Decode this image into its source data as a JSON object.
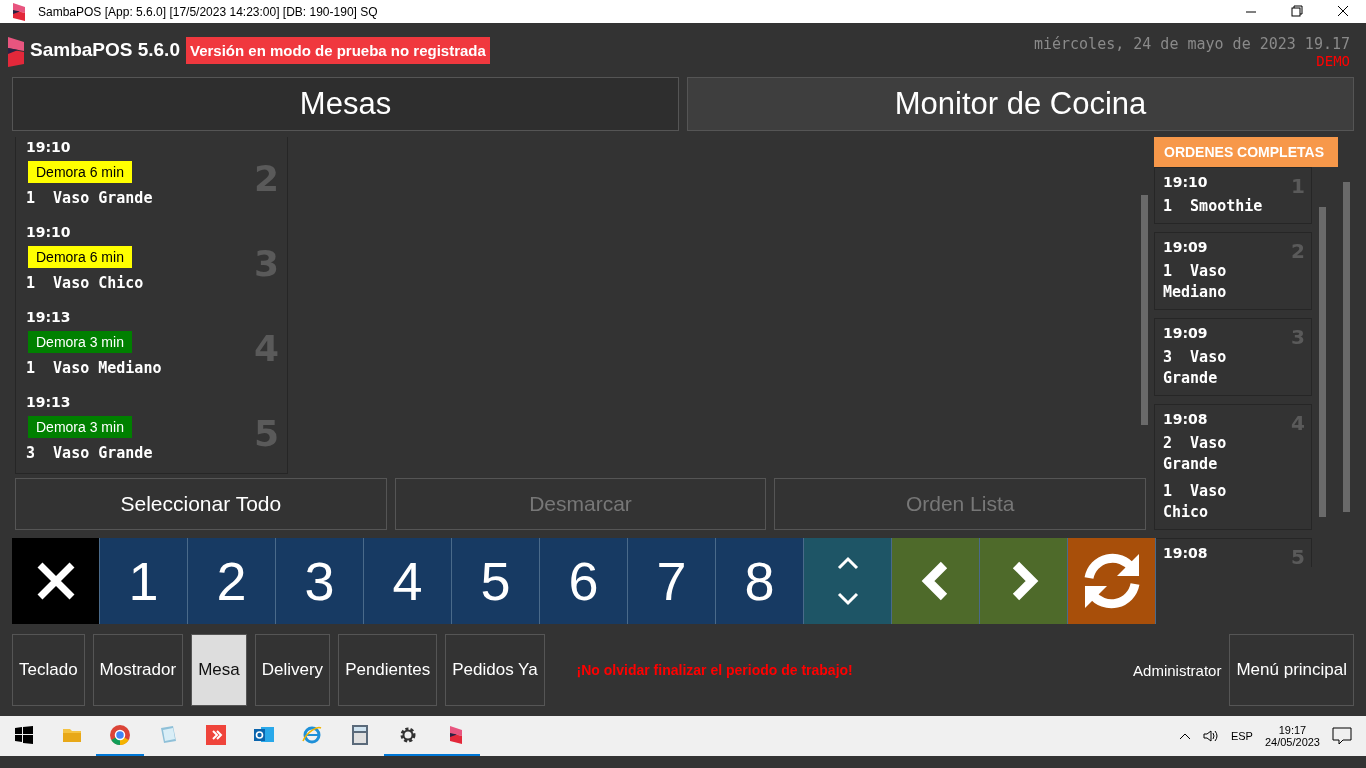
{
  "window": {
    "title": "SambaPOS [App: 5.6.0] [17/5/2023 14:23:00] [DB: 190-190] SQ"
  },
  "header": {
    "brand": "SambaPOS 5.6.0",
    "trial_notice": "Versión en modo de prueba no registrada",
    "date": "miércoles, 24 de mayo de 2023 19.17",
    "mode": "DEMO"
  },
  "tabs": [
    {
      "label": "Mesas",
      "selected": false
    },
    {
      "label": "Monitor de Cocina",
      "selected": true
    }
  ],
  "pending_orders": [
    {
      "time": "19:10",
      "delay": "Demora 6 min",
      "color": "#ffff00",
      "items": [
        "1  Vaso Grande"
      ],
      "number": "2"
    },
    {
      "time": "19:10",
      "delay": "Demora 6 min",
      "color": "#ffff00",
      "items": [
        "1  Vaso Chico"
      ],
      "number": "3"
    },
    {
      "time": "19:13",
      "delay": "Demora 3 min",
      "color": "#008000",
      "items": [
        "1  Vaso Mediano"
      ],
      "number": "4"
    },
    {
      "time": "19:13",
      "delay": "Demora 3 min",
      "color": "#008000",
      "items": [
        "3  Vaso Grande"
      ],
      "number": "5"
    }
  ],
  "completed": {
    "title": "ORDENES COMPLETAS",
    "orders": [
      {
        "time": "19:10",
        "items": [
          "1  Smoothie"
        ],
        "number": "1"
      },
      {
        "time": "19:09",
        "items": [
          "1  Vaso Mediano"
        ],
        "number": "2"
      },
      {
        "time": "19:09",
        "items": [
          "3  Vaso Grande"
        ],
        "number": "3"
      },
      {
        "time": "19:08",
        "items": [
          "2  Vaso Grande",
          "1  Vaso Chico"
        ],
        "number": "4"
      },
      {
        "time": "19:08",
        "number": "5"
      }
    ]
  },
  "actions": [
    {
      "label": "Seleccionar Todo",
      "disabled": false
    },
    {
      "label": "Desmarcar",
      "disabled": true
    },
    {
      "label": "Orden Lista",
      "disabled": true
    }
  ],
  "keypad": [
    {
      "kind": "close"
    },
    {
      "kind": "digit",
      "label": "1"
    },
    {
      "kind": "digit",
      "label": "2"
    },
    {
      "kind": "digit",
      "label": "3"
    },
    {
      "kind": "digit",
      "label": "4"
    },
    {
      "kind": "digit",
      "label": "5"
    },
    {
      "kind": "digit",
      "label": "6"
    },
    {
      "kind": "digit",
      "label": "7"
    },
    {
      "kind": "digit",
      "label": "8"
    },
    {
      "kind": "updown"
    },
    {
      "kind": "prev"
    },
    {
      "kind": "next"
    },
    {
      "kind": "refresh"
    }
  ],
  "bottom_bar": {
    "buttons": [
      {
        "label": "Teclado",
        "selected": false
      },
      {
        "label": "Mostrador",
        "selected": false
      },
      {
        "label": "Mesa",
        "selected": true
      },
      {
        "label": "Delivery",
        "selected": false
      },
      {
        "label": "Pendientes",
        "selected": false
      },
      {
        "label": "Pedidos Ya",
        "selected": false
      }
    ],
    "warning": "¡No olvidar finalizar el periodo de trabajo!",
    "user": "Administrator",
    "menu": "Menú principal"
  },
  "taskbar": {
    "apps": [
      {
        "kind": "folder",
        "running": false
      },
      {
        "kind": "chrome",
        "running": true
      },
      {
        "kind": "notepad",
        "running": false
      },
      {
        "kind": "anydesk",
        "running": false
      },
      {
        "kind": "outlook",
        "running": false
      },
      {
        "kind": "ie",
        "running": false
      },
      {
        "kind": "calculator",
        "running": false
      },
      {
        "kind": "settings",
        "running": true
      },
      {
        "kind": "samba",
        "running": true
      }
    ],
    "language": "ESP",
    "time": "19:17",
    "date": "24/05/2023"
  }
}
